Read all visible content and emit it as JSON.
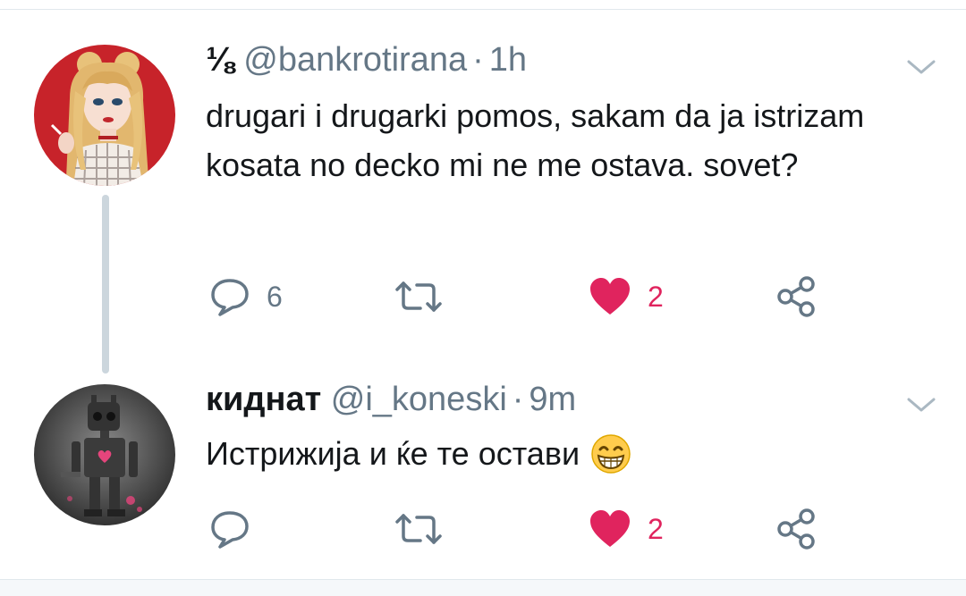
{
  "tweets": [
    {
      "display_name": "⅛",
      "handle": "@bankrotirana",
      "separator": "·",
      "time": "1h",
      "text": "drugari i drugarki pomos, sakam da ja istrizam kosata no decko mi ne me ostava. sovet?",
      "reply_count": "6",
      "like_count": "2",
      "liked": true
    },
    {
      "display_name": "киднат",
      "handle": "@i_koneski",
      "separator": "·",
      "time": "9m",
      "text": "Истрижија и ќе те остави",
      "emoji": "grinning-face-with-smiling-eyes",
      "reply_count": "",
      "like_count": "2",
      "liked": true
    }
  ],
  "icons": [
    "reply-icon",
    "retweet-icon",
    "heart-icon",
    "share-icon",
    "chevron-down-icon"
  ],
  "colors": {
    "like": "#e0245e",
    "muted": "#657786",
    "text": "#14171a",
    "thread_line": "#ccd6dd"
  }
}
